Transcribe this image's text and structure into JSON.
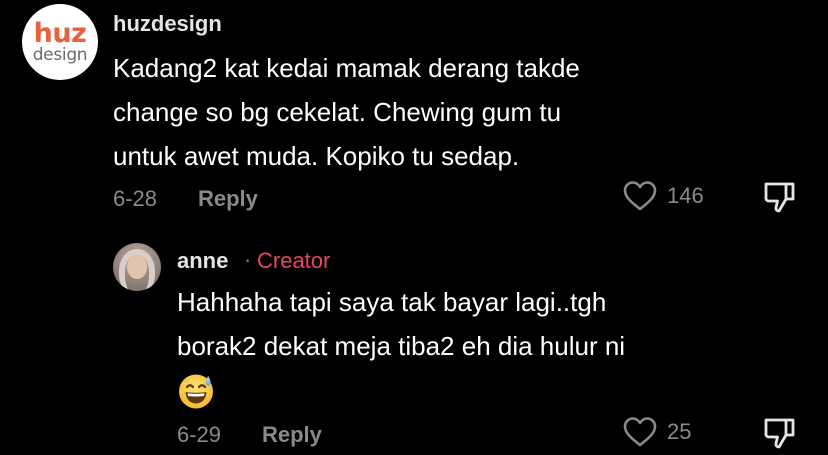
{
  "comments": [
    {
      "username": "huzdesign",
      "avatar": {
        "brand_top": "huz",
        "brand_bottom": "design"
      },
      "text": "Kadang2 kat kedai mamak derang takde\nchange so bg cekelat. Chewing gum tu\nuntuk awet muda. Kopiko tu sedap.",
      "date": "6-28",
      "reply_label": "Reply",
      "likes": "146",
      "like_icon": "heart-outline-icon",
      "dislike_icon": "thumbs-down-outline-icon"
    },
    {
      "username": "anne",
      "separator": "·",
      "badge": "Creator",
      "text": "Hahhaha tapi saya tak bayar lagi..tgh\nborak2 dekat meja tiba2 eh dia hulur ni",
      "emoji": "grinning-face-with-sweat-emoji",
      "date": "6-29",
      "reply_label": "Reply",
      "likes": "25",
      "like_icon": "heart-outline-icon",
      "dislike_icon": "thumbs-down-outline-icon"
    }
  ],
  "colors": {
    "background": "#000000",
    "brand_orange": "#e8603c",
    "creator_badge": "#e84565",
    "secondary_text": "#8a8a8a"
  }
}
